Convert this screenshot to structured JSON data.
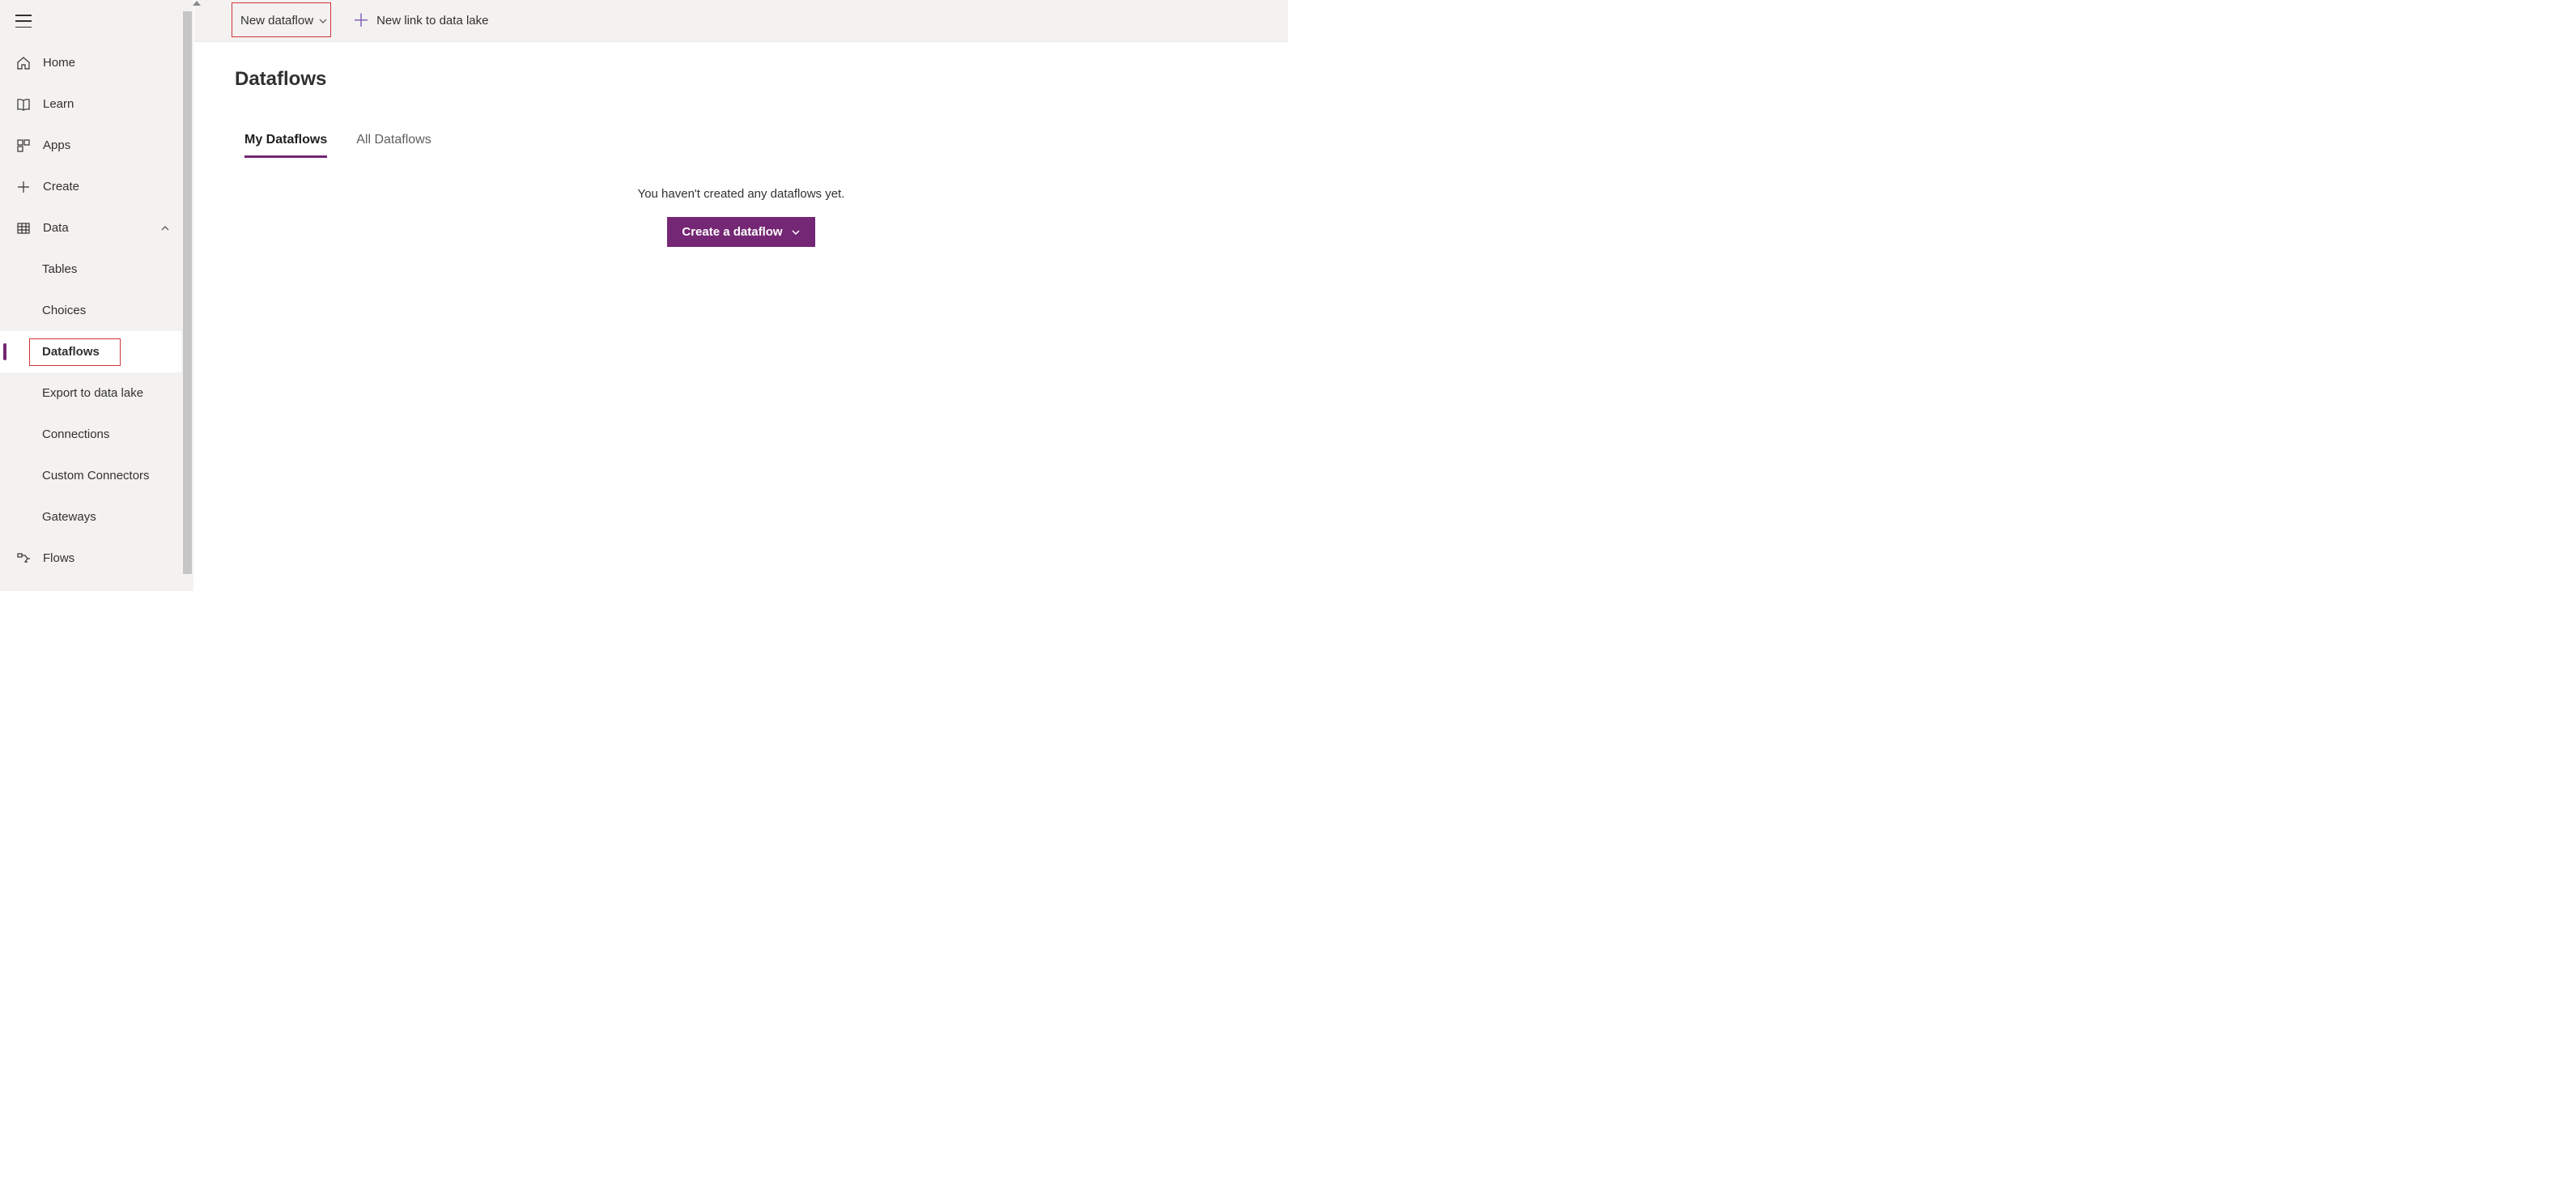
{
  "sidebar": {
    "items": [
      {
        "label": "Home"
      },
      {
        "label": "Learn"
      },
      {
        "label": "Apps"
      },
      {
        "label": "Create"
      },
      {
        "label": "Data"
      },
      {
        "label": "Flows"
      }
    ],
    "data_sub": [
      {
        "label": "Tables"
      },
      {
        "label": "Choices"
      },
      {
        "label": "Dataflows"
      },
      {
        "label": "Export to data lake"
      },
      {
        "label": "Connections"
      },
      {
        "label": "Custom Connectors"
      },
      {
        "label": "Gateways"
      }
    ]
  },
  "toolbar": {
    "new_dataflow": "New dataflow",
    "new_link": "New link to data lake"
  },
  "page": {
    "title": "Dataflows",
    "tabs": [
      {
        "label": "My Dataflows",
        "active": true
      },
      {
        "label": "All Dataflows",
        "active": false
      }
    ],
    "empty_text": "You haven't created any dataflows yet.",
    "create_button": "Create a dataflow"
  }
}
